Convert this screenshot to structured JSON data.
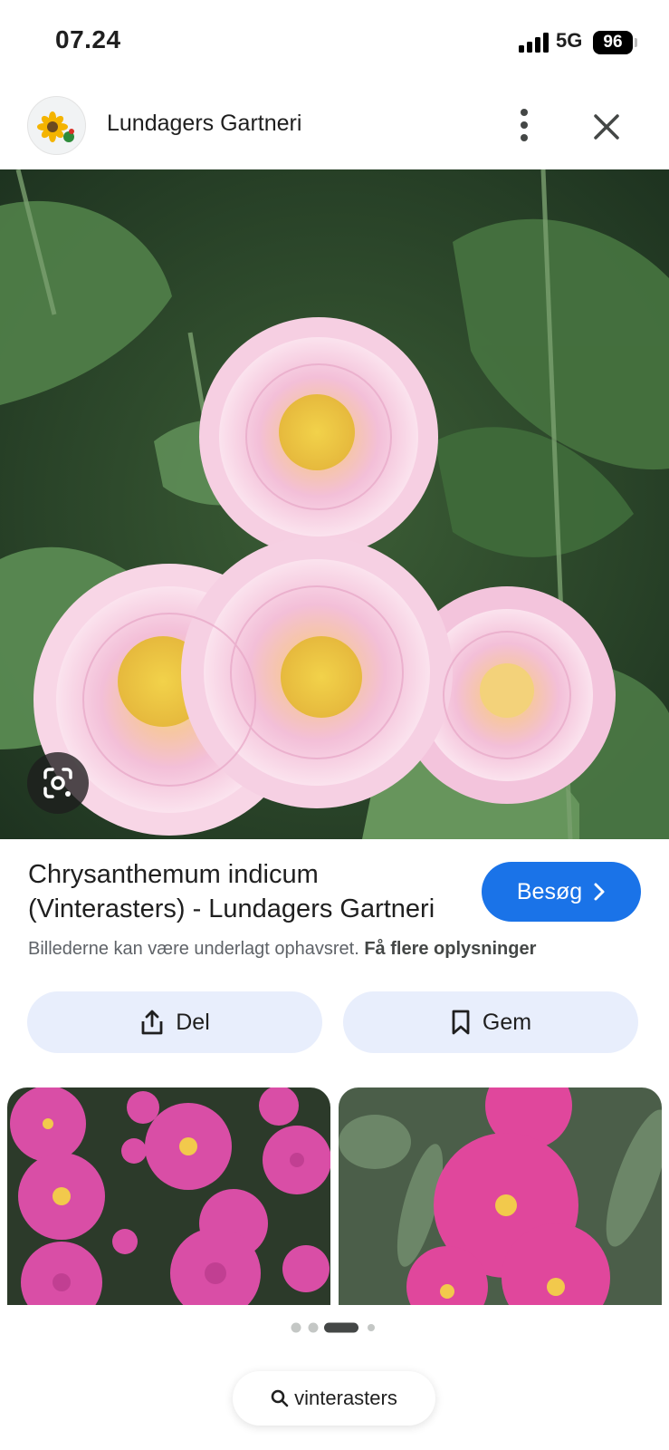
{
  "status_bar": {
    "time": "07.24",
    "network": "5G",
    "battery": "96"
  },
  "header": {
    "site_name": "Lundagers Gartneri",
    "logo_icon": "sunflower-logo-icon",
    "more_icon": "more-vertical-icon",
    "close_icon": "close-icon"
  },
  "hero": {
    "lens_icon": "google-lens-icon"
  },
  "result": {
    "title_line1": "Chrysanthemum indicum",
    "title_line2": "(Vinterasters) - Lundagers Gartneri",
    "visit_label": "Besøg",
    "copyright_text": "Billederne kan være underlagt ophavsret.",
    "more_info_link": "Få flere oplysninger"
  },
  "actions": {
    "share_label": "Del",
    "save_label": "Gem"
  },
  "pager": {
    "total": 4,
    "active": 3
  },
  "search": {
    "query": "vinterasters"
  },
  "colors": {
    "accent": "#1a73e8",
    "action_bg": "#e8eefc",
    "petal_light": "#f5c9de",
    "petal_magenta": "#dc4fa5",
    "center_yellow": "#f2d24a",
    "foliage": "#3e6a3a"
  }
}
